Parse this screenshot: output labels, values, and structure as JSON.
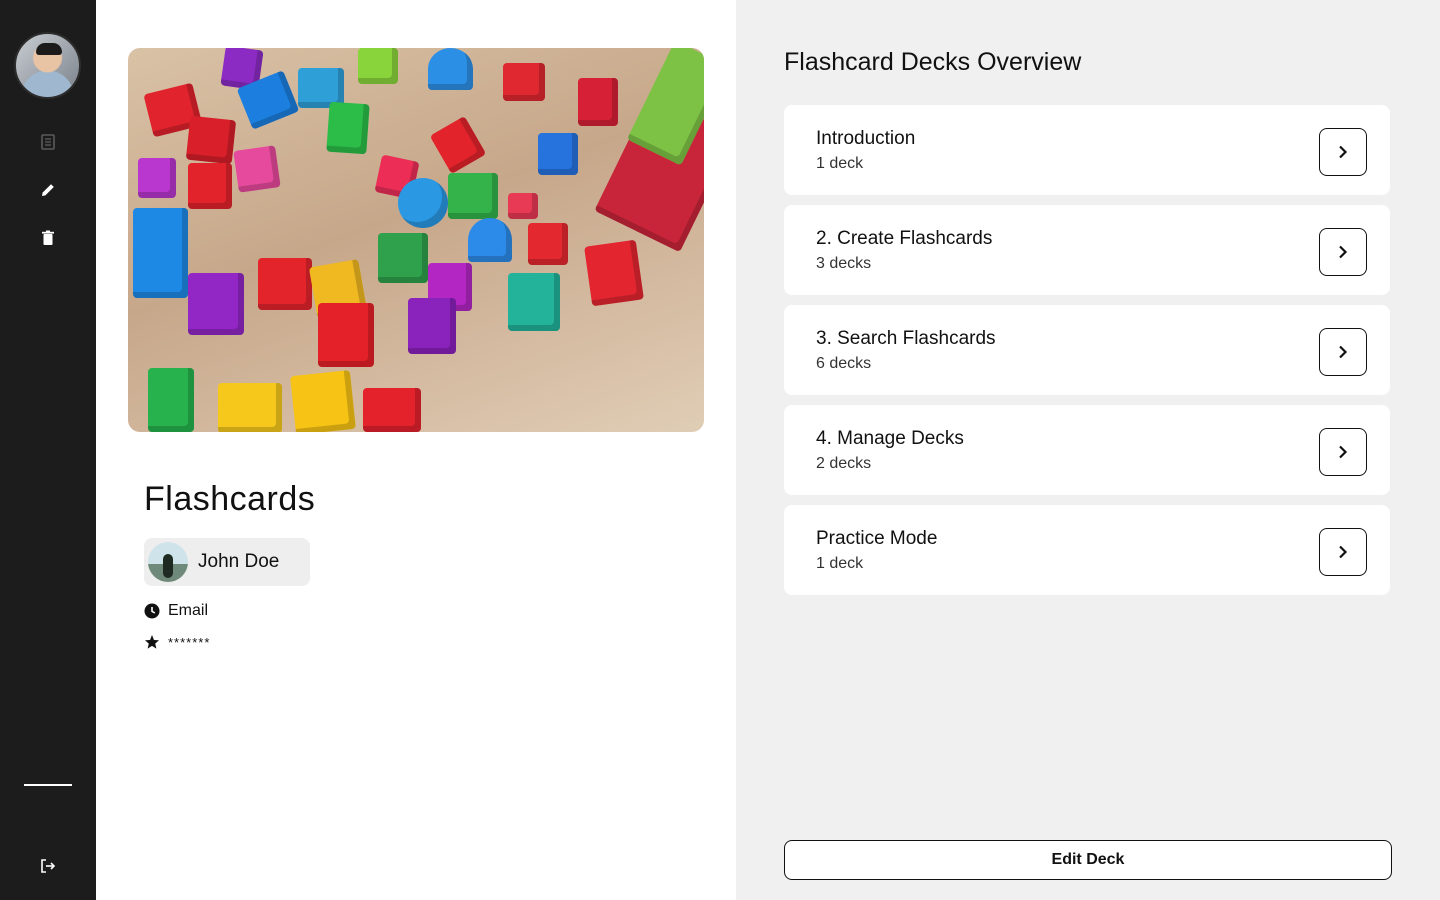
{
  "sidebar": {
    "icons": [
      "list-icon",
      "pencil-icon",
      "trash-icon",
      "logout-icon"
    ]
  },
  "main": {
    "title": "Flashcards",
    "user_name": "John Doe",
    "email_label": "Email",
    "password_mask": "*******"
  },
  "overview": {
    "title": "Flashcard Decks Overview",
    "decks": [
      {
        "name": "Introduction",
        "count": "1 deck"
      },
      {
        "name": "2. Create Flashcards",
        "count": "3 decks"
      },
      {
        "name": "3. Search Flashcards",
        "count": "6 decks"
      },
      {
        "name": "4. Manage Decks",
        "count": "2 decks"
      },
      {
        "name": "Practice Mode",
        "count": "1 deck"
      }
    ],
    "edit_label": "Edit Deck"
  },
  "colors": {
    "sidebar_bg": "#1c1c1c",
    "panel_bg": "#f0f0f0",
    "card_bg": "#ffffff"
  }
}
